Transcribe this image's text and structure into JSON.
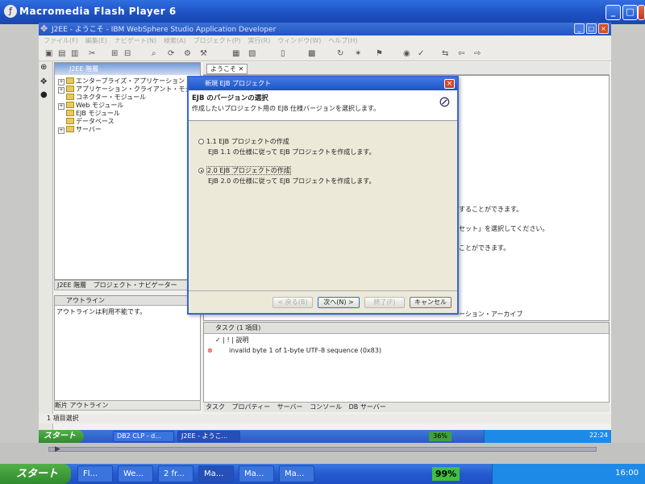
{
  "outer_window": {
    "title": "Macromedia Flash Player 6"
  },
  "inner_window": {
    "title": "J2EE - ようこそ - IBM WebSphere Studio Application Developer",
    "menu": [
      "ファイル(F)",
      "編集(E)",
      "ナビゲート(N)",
      "検索(A)",
      "プロジェクト(P)",
      "実行(R)",
      "ウィンドウ(W)",
      "ヘルプ(H)"
    ]
  },
  "navigator": {
    "title": "J2EE 階層",
    "items": [
      "エンタープライズ・アプリケーション",
      "アプリケーション・クライアント・モジュール",
      "コネクター・モジュール",
      "Web モジュール",
      "EJB モジュール",
      "データベース",
      "サーバー"
    ],
    "tabs": [
      "J2EE 階層",
      "プロジェクト・ナビゲーター"
    ]
  },
  "outline": {
    "title": "アウトライン",
    "message": "アウトラインは利用不能です。",
    "tabs": [
      "断片",
      "アウトライン"
    ]
  },
  "editor": {
    "tab": "ようこそ",
    "snippets": [
      "することができます。",
      "セット」を選択してください。",
      "ことができます。",
      "ーション・アーカイブ"
    ]
  },
  "tasks": {
    "title": "タスク (1 項目)",
    "col_desc": "説明",
    "row_desc": "invalid byte 1 of 1-byte UTF-8 sequence (0x83)",
    "tabs": [
      "タスク",
      "プロパティー",
      "サーバー",
      "コンソール",
      "DB サーバー"
    ]
  },
  "status": "1 項目選択",
  "dialog": {
    "title": "新規 EJB プロジェクト",
    "heading": "EJB のバージョンの選択",
    "description": "作成したいプロジェクト用の EJB 仕様バージョンを選択します。",
    "opt1_label": "1.1 EJB プロジェクトの作成",
    "opt1_desc": "EJB 1.1 の仕様に従って EJB プロジェクトを作成します。",
    "opt2_label": "2.0 EJB プロジェクトの作成",
    "opt2_desc": "EJB 2.0 の仕様に従って EJB プロジェクトを作成します。",
    "selected": "2.0",
    "btn_back": "< 戻る(B)",
    "btn_next": "次へ(N) >",
    "btn_finish": "終了(F)",
    "btn_cancel": "キャンセル"
  },
  "inner_taskbar": {
    "start": "スタート",
    "items": [
      "DB2 CLP - d...",
      "J2EE - ようこ..."
    ],
    "zoom": "36%",
    "clock": "22:24"
  },
  "outer_taskbar": {
    "start": "スタート",
    "items": [
      "Fl...",
      "We...",
      "2 fr...",
      "Ma...",
      "Ma...",
      "Ma..."
    ],
    "zoom": "99%",
    "clock": "16:00"
  }
}
